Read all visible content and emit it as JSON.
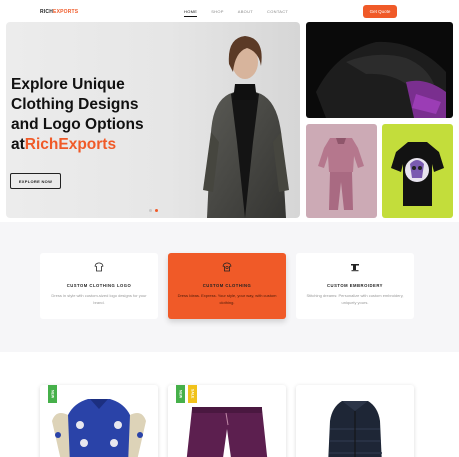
{
  "brand": {
    "prefix": "RICH",
    "suffix": "EXPORTS",
    "accent": "#f05a28"
  },
  "nav": {
    "items": [
      "HOME",
      "SHOP",
      "ABOUT",
      "CONTACT"
    ],
    "active_index": 0
  },
  "header": {
    "cta_label": "Get Quote"
  },
  "hero": {
    "title_line1": "Explore Unique",
    "title_line2": "Clothing Designs",
    "title_line3": "and Logo Options",
    "title_prefix": "at",
    "title_brand": "RichExports",
    "button_label": "EXPLORE NOW",
    "slide_count": 2,
    "active_slide": 1
  },
  "services": [
    {
      "title": "CUSTOM CLOTHING LOGO",
      "description": "Dress in style with custom-sized logo designs for your brand.",
      "icon": "shirt-icon",
      "active": false
    },
    {
      "title": "CUSTOM CLOTHING",
      "description": "Dress Ideas. Express. Your style, your way, with custom clothing.",
      "icon": "tshirt-icon",
      "active": true
    },
    {
      "title": "CUSTOM EMBROIDERY",
      "description": "Stitching dreams: Personalize with custom embroidery, uniquely yours.",
      "icon": "sewing-icon",
      "active": false
    }
  ],
  "products": [
    {
      "badge": "NEW",
      "badge_color": "#46b04a",
      "item": "varsity-jacket"
    },
    {
      "badge": "NEW",
      "badge_color": "#46b04a",
      "badge2": "SALE",
      "badge2_color": "#f1c21b",
      "item": "track-pants"
    },
    {
      "item": "puffer-vest"
    }
  ]
}
